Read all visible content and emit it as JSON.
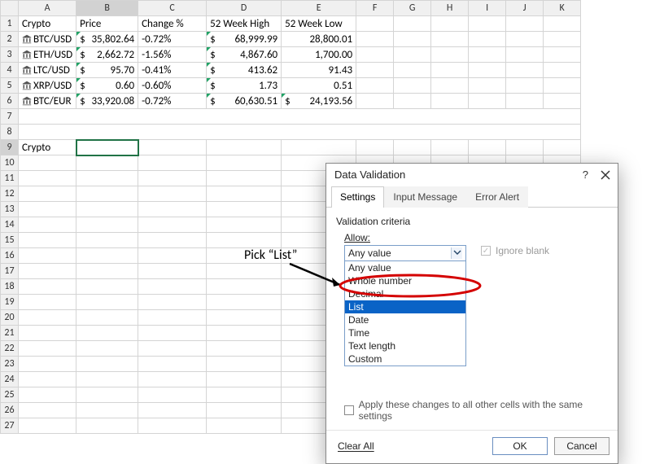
{
  "columns": [
    "A",
    "B",
    "C",
    "D",
    "E",
    "F",
    "G",
    "H",
    "I",
    "J",
    "K"
  ],
  "headers": {
    "A": "Crypto",
    "B": "Price",
    "C": "Change %",
    "D": "52 Week High",
    "E": "52 Week Low"
  },
  "rows": [
    {
      "sym": "BTC/USD",
      "price": "35,802.64",
      "chg": "-0.72%",
      "high": "68,999.99",
      "low": "28,800.01",
      "lowTri": false
    },
    {
      "sym": "ETH/USD",
      "price": "2,662.72",
      "chg": "-1.56%",
      "high": "4,867.60",
      "low": "1,700.00",
      "lowTri": false
    },
    {
      "sym": "LTC/USD",
      "price": "95.70",
      "chg": "-0.41%",
      "high": "413.62",
      "low": "91.43",
      "lowTri": false
    },
    {
      "sym": "XRP/USD",
      "price": "0.60",
      "chg": "-0.60%",
      "high": "1.73",
      "low": "0.51",
      "lowTri": false
    },
    {
      "sym": "BTC/EUR",
      "price": "33,920.08",
      "chg": "-0.72%",
      "high": "60,630.51",
      "low": "24,193.56",
      "lowTri": true
    }
  ],
  "row9A": "Crypto",
  "currency": "$",
  "dialog": {
    "title": "Data Validation",
    "help": "?",
    "tabs": [
      "Settings",
      "Input Message",
      "Error Alert"
    ],
    "activeTab": 0,
    "criteriaLabel": "Validation criteria",
    "allowLabel": "Allow:",
    "allowSelected": "Any value",
    "allowOptions": [
      "Any value",
      "Whole number",
      "Decimal",
      "List",
      "Date",
      "Time",
      "Text length",
      "Custom"
    ],
    "highlightIndex": 3,
    "ignoreBlank": "Ignore blank",
    "ignoreBlankChecked": true,
    "applyLabel": "Apply these changes to all other cells with the same settings",
    "clearAll": "Clear All",
    "ok": "OK",
    "cancel": "Cancel"
  },
  "annotation": {
    "text": "Pick “List”"
  }
}
